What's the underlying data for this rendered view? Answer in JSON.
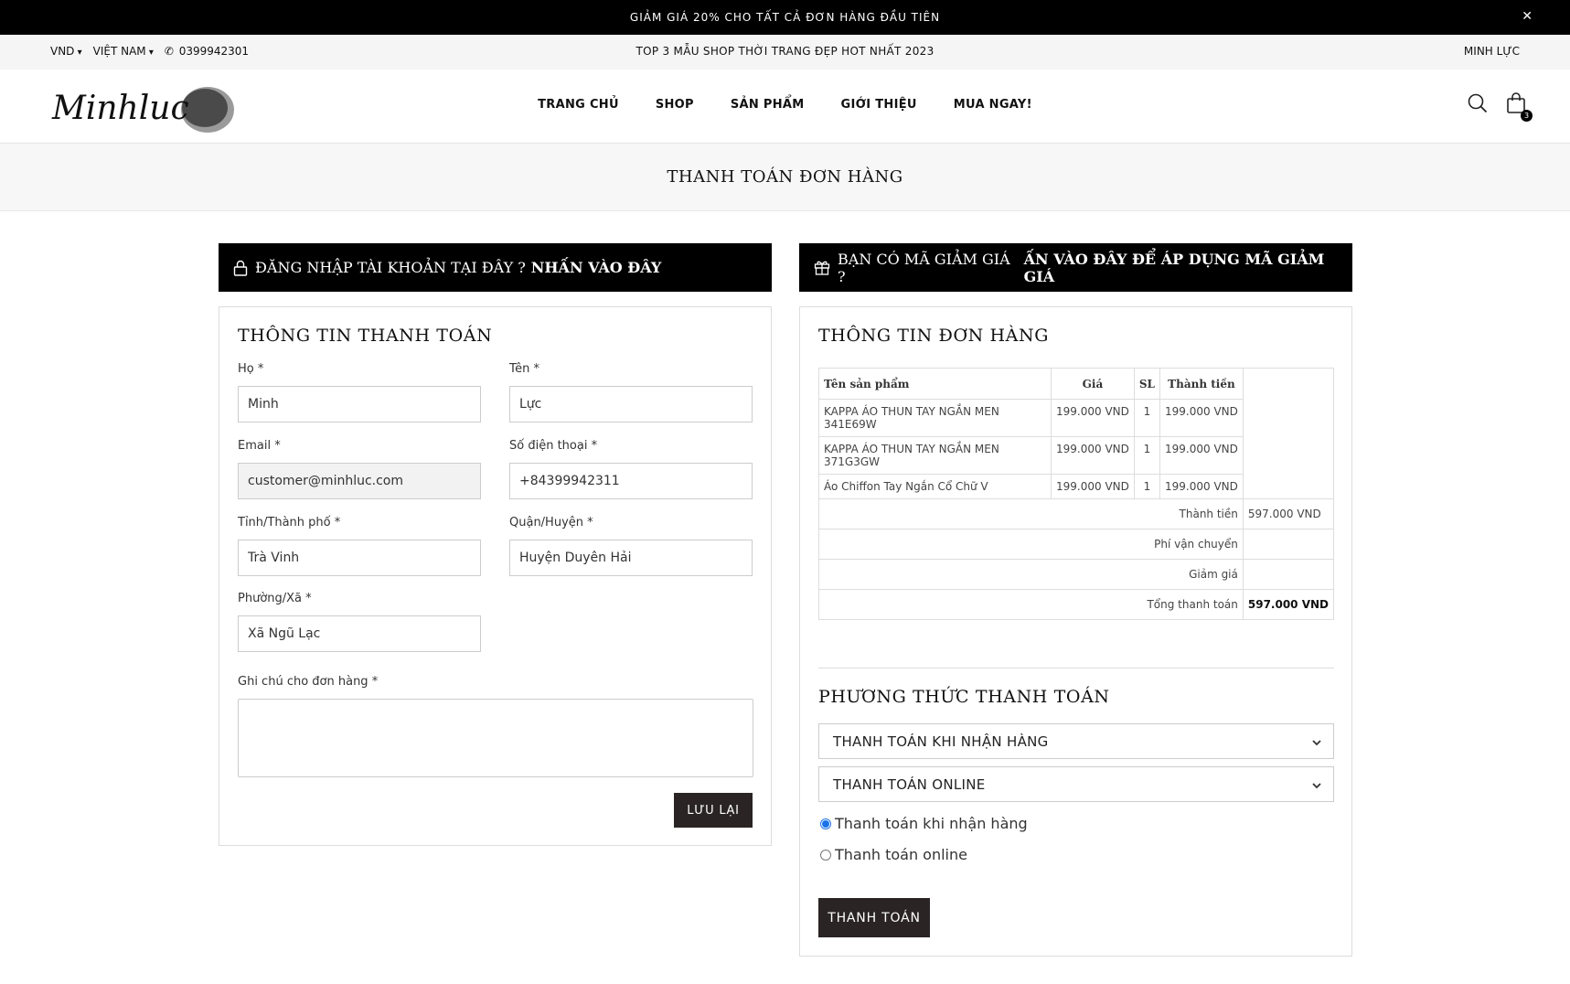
{
  "announcement": {
    "text": "GIẢM GIÁ 20% CHO TẤT CẢ ĐƠN HÀNG ĐẦU TIÊN",
    "close": "✕"
  },
  "topbar": {
    "currency": "VND",
    "country": "VIỆT NAM",
    "phone": "0399942301",
    "promo": "TOP 3 MẪU SHOP THỜI TRANG ĐẸP HOT NHẤT 2023",
    "user": "MINH LỰC"
  },
  "header": {
    "logo_text": "Minhluc",
    "nav": [
      "TRANG CHỦ",
      "SHOP",
      "SẢN PHẨM",
      "GIỚI THIỆU",
      "MUA NGAY!"
    ],
    "cart_count": "3"
  },
  "page_title": "THANH TOÁN ĐƠN HÀNG",
  "login_banner": {
    "text": "ĐĂNG NHẬP TÀI KHOẢN TẠI ĐÂY ?",
    "link": "NHẤN VÀO ĐÂY"
  },
  "coupon_banner": {
    "text": "BẠN CÓ MÃ GIẢM GIÁ ?",
    "link": "ẤN VÀO ĐÂY ĐỂ ÁP DỤNG MÃ GIẢM GIÁ"
  },
  "billing": {
    "title": "THÔNG TIN THANH TOÁN",
    "last_name": {
      "label": "Họ *",
      "value": "Minh"
    },
    "first_name": {
      "label": "Tên *",
      "value": "Lực"
    },
    "email": {
      "label": "Email *",
      "value": "customer@minhluc.com"
    },
    "phone": {
      "label": "Số điện thoại *",
      "value": "+84399942311"
    },
    "province": {
      "label": "Tỉnh/Thành phố *",
      "value": "Trà Vinh"
    },
    "district": {
      "label": "Quận/Huyện *",
      "value": "Huyện Duyên Hải"
    },
    "ward": {
      "label": "Phường/Xã *",
      "value": "Xã Ngũ Lạc"
    },
    "note": {
      "label": "Ghi chú cho đơn hàng *",
      "value": ""
    },
    "save_button": "LƯU LẠI"
  },
  "order": {
    "title": "THÔNG TIN ĐƠN HÀNG",
    "columns": [
      "Tên sản phẩm",
      "Giá",
      "SL",
      "Thành tiền"
    ],
    "rows": [
      {
        "name": "KAPPA ÁO THUN TAY NGẮN MEN 341E69W",
        "price": "199.000 VND",
        "qty": "1",
        "total": "199.000 VND"
      },
      {
        "name": "KAPPA ÁO THUN TAY NGẮN MEN 371G3GW",
        "price": "199.000 VND",
        "qty": "1",
        "total": "199.000 VND"
      },
      {
        "name": "Áo Chiffon Tay Ngắn Cổ Chữ V",
        "price": "199.000 VND",
        "qty": "1",
        "total": "199.000 VND"
      }
    ],
    "subtotal_label": "Thành tiền",
    "subtotal_value": "597.000 VND",
    "shipping_label": "Phí vận chuyển",
    "shipping_value": "",
    "discount_label": "Giảm giá",
    "discount_value": "",
    "grand_total_label": "Tổng thanh toán",
    "grand_total_value": "597.000 VND"
  },
  "payment": {
    "title": "PHƯƠNG THỨC THANH TOÁN",
    "accordion_cod": "THANH TOÁN KHI NHẬN HÀNG",
    "accordion_online": "THANH TOÁN ONLINE",
    "radio_cod": "Thanh toán khi nhận hàng",
    "radio_online": "Thanh toán online",
    "selected": "cod",
    "pay_button": "THANH TOÁN"
  },
  "colors": {
    "accent": "#000000",
    "button": "#2a2424",
    "radio": "#1a73e8"
  }
}
